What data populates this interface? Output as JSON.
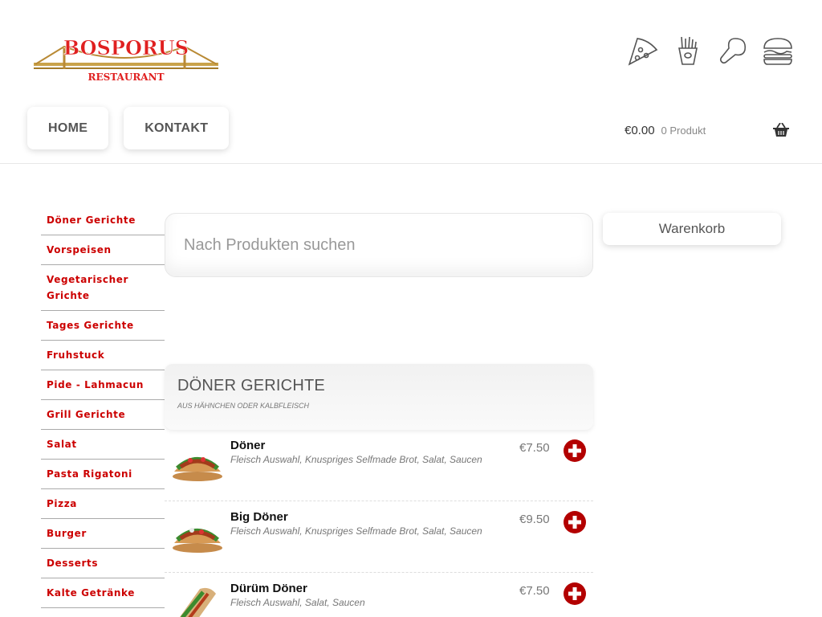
{
  "header": {
    "logo_title": "BOSPORUS",
    "logo_subtitle": "RESTAURANT",
    "food_icons": [
      "pizza-icon",
      "fries-icon",
      "chicken-leg-icon",
      "burger-icon"
    ]
  },
  "nav": {
    "home": "HOME",
    "kontakt": "KONTAKT"
  },
  "cart": {
    "total": "€0.00",
    "count": "0 Produkt",
    "icon": "basket-icon"
  },
  "sidebar": {
    "items": [
      "Döner Gerichte",
      "Vorspeisen",
      "Vegetarischer Grichte",
      "Tages Gerichte",
      "Fruhstuck",
      "Pide - Lahmacun",
      "Grill Gerichte",
      "Salat",
      "Pasta Rigatoni",
      "Pizza",
      "Burger",
      "Desserts",
      "Kalte Getränke"
    ]
  },
  "search": {
    "placeholder": "Nach Produkten suchen"
  },
  "warenkorb": {
    "label": "Warenkorb"
  },
  "category": {
    "title": "DÖNER GERICHTE",
    "subtitle": "AUS HÄHNCHEN ODER KALBFLEISCH"
  },
  "products": [
    {
      "name": "Döner",
      "desc": "Fleisch Auswahl, Knuspriges Selfmade Brot, Salat, Saucen",
      "price": "€7.50"
    },
    {
      "name": "Big Döner",
      "desc": "Fleisch Auswahl, Knuspriges Selfmade Brot, Salat, Saucen",
      "price": "€9.50"
    },
    {
      "name": "Dürüm Döner",
      "desc": "Fleisch Auswahl, Salat, Saucen",
      "price": "€7.50"
    }
  ],
  "colors": {
    "accent_red": "#cc0000",
    "add_button_red": "#b30000"
  }
}
